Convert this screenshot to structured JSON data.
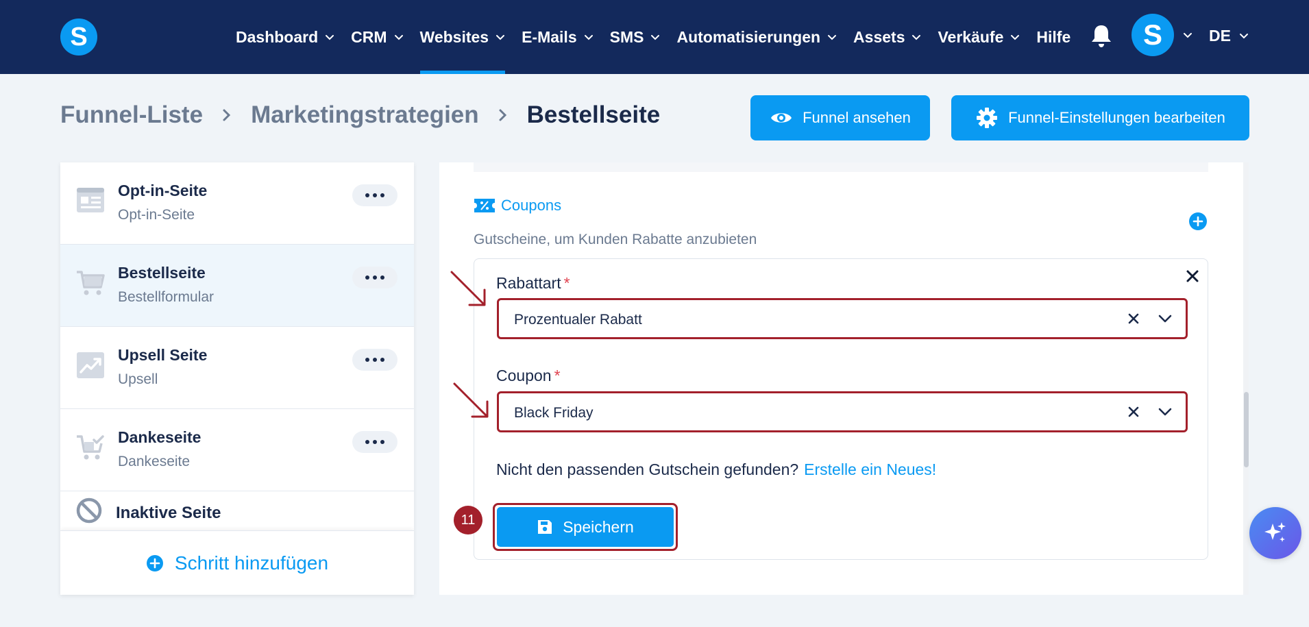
{
  "nav": {
    "logo": "S",
    "items": [
      {
        "label": "Dashboard"
      },
      {
        "label": "CRM"
      },
      {
        "label": "Websites"
      },
      {
        "label": "E-Mails"
      },
      {
        "label": "SMS"
      },
      {
        "label": "Automatisierungen"
      },
      {
        "label": "Assets"
      },
      {
        "label": "Verkäufe"
      }
    ],
    "help": "Hilfe",
    "avatar": "S",
    "lang": "DE",
    "active_item": "Websites"
  },
  "breadcrumb": {
    "items": [
      "Funnel-Liste",
      "Marketingstrategien"
    ],
    "current": "Bestellseite"
  },
  "header_buttons": {
    "view": "Funnel ansehen",
    "settings": "Funnel-Einstellungen bearbeiten"
  },
  "sidebar": {
    "steps": [
      {
        "title": "Opt-in-Seite",
        "subtitle": "Opt-in-Seite",
        "icon": "page-form-icon"
      },
      {
        "title": "Bestellseite",
        "subtitle": "Bestellformular",
        "icon": "cart-icon"
      },
      {
        "title": "Upsell Seite",
        "subtitle": "Upsell",
        "icon": "trend-up-icon"
      },
      {
        "title": "Dankeseite",
        "subtitle": "Dankeseite",
        "icon": "cart-check-icon"
      }
    ],
    "inactive": "Inaktive Seite",
    "add_step": "Schritt hinzufügen",
    "selected_step": "Bestellseite"
  },
  "coupons": {
    "title": "Coupons",
    "description": "Gutscheine, um Kunden Rabatte anzubieten",
    "discount_type": {
      "label": "Rabattart",
      "required": "*",
      "value": "Prozentualer Rabatt"
    },
    "coupon": {
      "label": "Coupon",
      "required": "*",
      "value": "Black Friday"
    },
    "hint": "Nicht den passenden Gutschein gefunden?",
    "hint_link": "Erstelle ein Neues!",
    "save": "Speichern",
    "step_number": "11"
  },
  "colors": {
    "nav_bg": "#13295c",
    "primary": "#0a9af2",
    "highlight": "#a3202b",
    "background": "#f0f4f8"
  }
}
